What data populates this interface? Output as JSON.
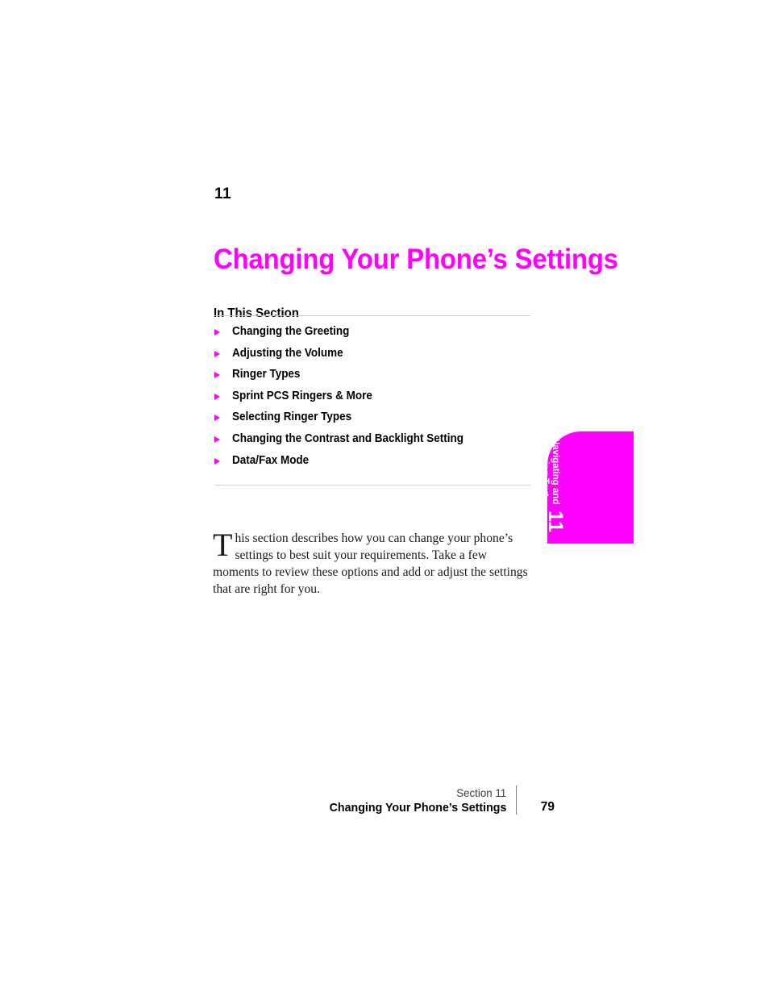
{
  "page": {
    "section_number": "11",
    "chapter_title": "Changing Your Phone’s Settings",
    "in_this_section_heading": "In This Section",
    "accent_color": "#ff00ff",
    "text_color": "#000000",
    "rule_color": "#c9c9c9"
  },
  "toc": {
    "items": [
      {
        "label": "Changing the Greeting",
        "bullet": "triangle-right-icon"
      },
      {
        "label": "Adjusting the Volume",
        "bullet": "triangle-right-icon"
      },
      {
        "label": "Ringer Types",
        "bullet": "triangle-right-icon"
      },
      {
        "label": "Sprint PCS Ringers & More",
        "bullet": "triangle-right-icon"
      },
      {
        "label": "Selecting Ringer Types",
        "bullet": "triangle-right-icon"
      },
      {
        "label": "Changing the Contrast and Backlight Setting",
        "bullet": "triangle-right-icon"
      },
      {
        "label": "Data/Fax Mode",
        "bullet": "triangle-right-icon"
      }
    ]
  },
  "intro": {
    "dropcap": "T",
    "body": "his section describes how you can change your phone’s settings to best suit your requirements. Take a few moments to review these options and add or adjust the settings that are right for you."
  },
  "side_tab": {
    "line1": "Navigating and",
    "line2": "Entering Text",
    "number": "11",
    "background_color": "#ff00ff",
    "text_color": "#ffffff"
  },
  "footer": {
    "section_label": "Section 11",
    "title": "Changing Your Phone’s Settings",
    "page_number": "79"
  }
}
